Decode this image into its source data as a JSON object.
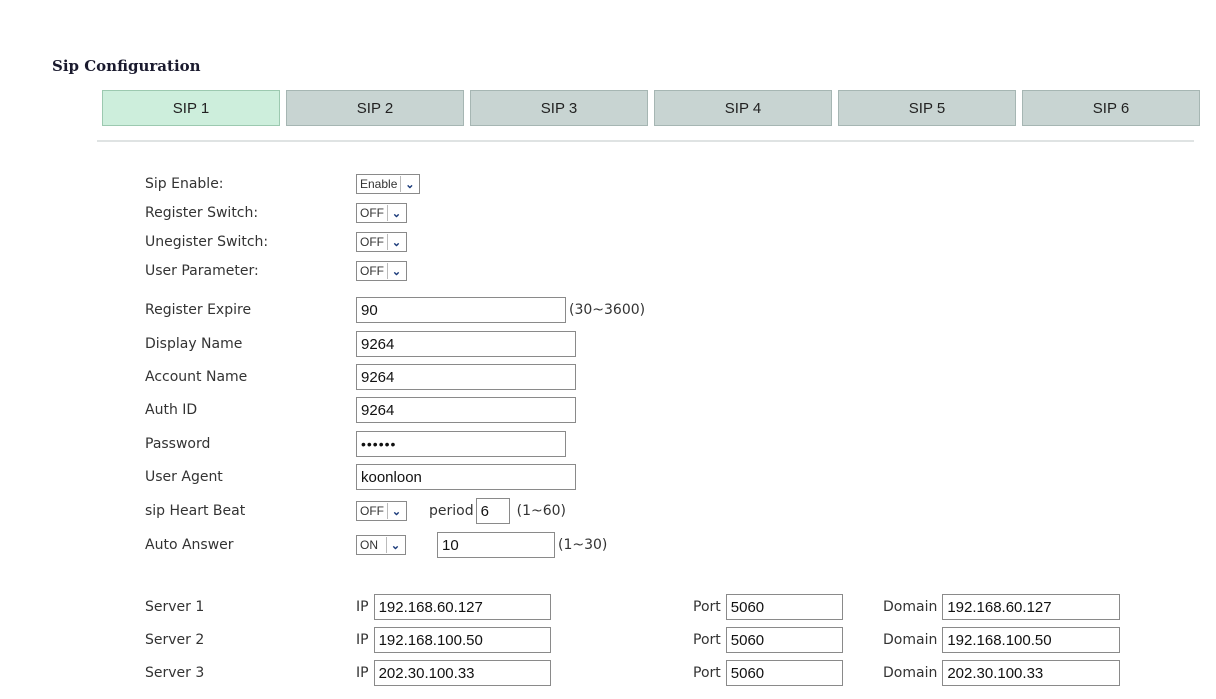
{
  "section_title": "Sip Configuration",
  "tabs": [
    "SIP 1",
    "SIP 2",
    "SIP 3",
    "SIP 4",
    "SIP 5",
    "SIP 6"
  ],
  "active_tab": 0,
  "fields": {
    "sip_enable": {
      "label": "Sip Enable:",
      "value": "Enable"
    },
    "register_switch": {
      "label": "Register Switch:",
      "value": "OFF"
    },
    "unregister_switch": {
      "label": "Unegister Switch:",
      "value": "OFF"
    },
    "user_parameter": {
      "label": "User Parameter:",
      "value": "OFF"
    },
    "register_expire": {
      "label": "Register Expire",
      "value": "90",
      "hint": "(30~3600)"
    },
    "display_name": {
      "label": "Display Name",
      "value": "9264"
    },
    "account_name": {
      "label": "Account Name",
      "value": "9264"
    },
    "auth_id": {
      "label": "Auth ID",
      "value": "9264"
    },
    "password": {
      "label": "Password",
      "value": "••••••"
    },
    "user_agent": {
      "label": "User Agent",
      "value": "koonloon"
    },
    "sip_heart_beat": {
      "label": "sip Heart Beat",
      "value": "OFF",
      "period_label": "period",
      "period_value": "6",
      "hint": "(1~60)"
    },
    "auto_answer": {
      "label": "Auto Answer",
      "value": "ON",
      "seconds": "10",
      "hint": "(1~30)"
    }
  },
  "servers": [
    {
      "label": "Server 1",
      "ip_label": "IP",
      "ip": "192.168.60.127",
      "port_label": "Port",
      "port": "5060",
      "domain_label": "Domain",
      "domain": "192.168.60.127"
    },
    {
      "label": "Server 2",
      "ip_label": "IP",
      "ip": "192.168.100.50",
      "port_label": "Port",
      "port": "5060",
      "domain_label": "Domain",
      "domain": "192.168.100.50"
    },
    {
      "label": "Server 3",
      "ip_label": "IP",
      "ip": "202.30.100.33",
      "port_label": "Port",
      "port": "5060",
      "domain_label": "Domain",
      "domain": "202.30.100.33"
    }
  ],
  "icons": {
    "dropdown": "chevron-down-icon"
  },
  "colors": {
    "active_tab": "#cdeedc",
    "inactive_tab": "#c8d4d2",
    "divider": "#dfe3e3"
  }
}
